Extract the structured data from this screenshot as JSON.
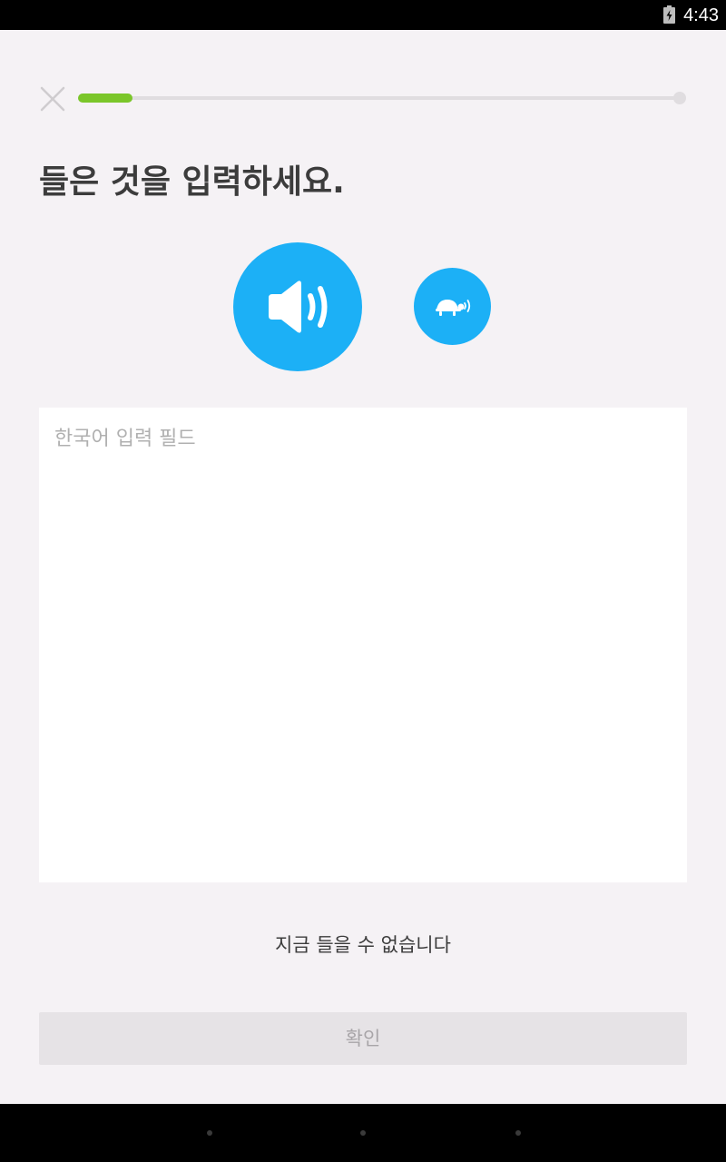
{
  "status_bar": {
    "time": "4:43",
    "battery_icon": "battery-charging-icon"
  },
  "header": {
    "close_icon": "close-icon",
    "progress": 0.09
  },
  "prompt": {
    "instruction": "들은 것을 입력하세요."
  },
  "audio": {
    "play_icon": "speaker-icon",
    "slow_icon": "turtle-icon"
  },
  "answer": {
    "placeholder": "한국어 입력 필드",
    "value": ""
  },
  "links": {
    "cant_listen": "지금 들을 수 없습니다"
  },
  "footer": {
    "check_label": "확인"
  },
  "nav_bar": {
    "buttons": [
      "back",
      "home",
      "recents"
    ]
  },
  "colors": {
    "accent_blue": "#1cb0f6",
    "progress_green": "#7bc62a",
    "background": "#f5f2f5"
  }
}
